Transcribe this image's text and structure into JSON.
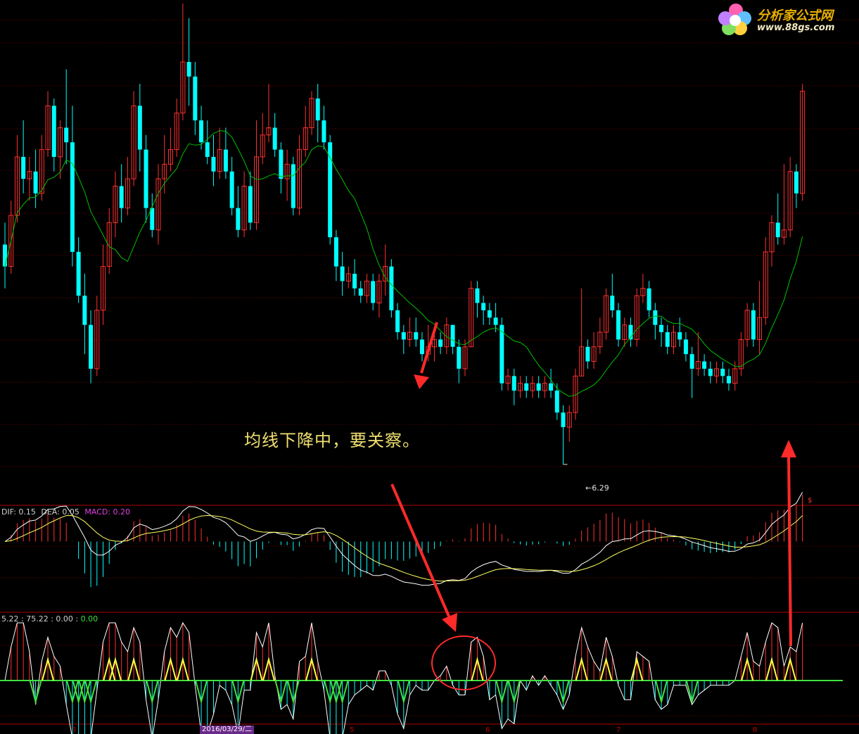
{
  "annotation": "均线下降中，要关察。",
  "logo": {
    "title": "分析家公式网",
    "url": "www.88gs.com"
  },
  "low_marker": "6.29",
  "macd_legend": {
    "dif_label": "DIF: 0.15",
    "dea_label": "DEA: 0.05",
    "macd_label": "MACD: 0.20"
  },
  "osc_legend": {
    "v1": "5.22",
    "v2": "75.22",
    "v3": "0.00",
    "v4": "0.00"
  },
  "x_ticks": [
    "3",
    "5",
    "6",
    "7",
    "8"
  ],
  "date_label": "2016/03/29/二",
  "dollar_mark": "$",
  "colors": {
    "up": "#ff3030",
    "down": "#00ffff",
    "ma": "#00c000",
    "dif": "#ffffff",
    "dea": "#ffff60",
    "grid": "#7a0000",
    "osc_green": "#40e040",
    "osc_yellow": "#ffff40",
    "arrow": "#ff2a2a"
  },
  "chart_data": [
    {
      "type": "candlestick",
      "series": [
        {
          "name": "price",
          "candles": [
            [
              9.3,
              9.0,
              9.6,
              8.7
            ],
            [
              9.0,
              9.7,
              9.9,
              8.9
            ],
            [
              9.7,
              10.5,
              10.8,
              9.6
            ],
            [
              10.5,
              10.2,
              11.0,
              10.0
            ],
            [
              10.2,
              10.3,
              10.5,
              9.9
            ],
            [
              10.3,
              10.0,
              10.6,
              9.8
            ],
            [
              10.0,
              10.6,
              10.8,
              9.9
            ],
            [
              10.6,
              11.2,
              11.4,
              10.5
            ],
            [
              11.2,
              10.5,
              11.3,
              10.3
            ],
            [
              10.5,
              10.9,
              11.0,
              10.2
            ],
            [
              10.9,
              10.7,
              11.7,
              10.4
            ],
            [
              10.7,
              9.2,
              11.2,
              9.0
            ],
            [
              9.2,
              8.6,
              9.4,
              8.5
            ],
            [
              8.6,
              8.2,
              8.9,
              7.8
            ],
            [
              8.2,
              7.6,
              8.4,
              7.4
            ],
            [
              7.6,
              8.4,
              8.6,
              7.5
            ],
            [
              8.4,
              9.0,
              9.3,
              8.2
            ],
            [
              9.0,
              9.6,
              9.8,
              8.9
            ],
            [
              9.6,
              10.1,
              10.3,
              9.4
            ],
            [
              10.1,
              9.8,
              10.4,
              9.6
            ],
            [
              9.8,
              10.2,
              10.5,
              9.7
            ],
            [
              10.2,
              11.2,
              11.4,
              10.1
            ],
            [
              11.2,
              10.6,
              11.5,
              10.3
            ],
            [
              10.6,
              9.8,
              10.8,
              9.6
            ],
            [
              9.8,
              9.5,
              10.0,
              9.4
            ],
            [
              9.5,
              10.2,
              10.4,
              9.3
            ],
            [
              10.2,
              10.4,
              10.8,
              10.0
            ],
            [
              10.4,
              10.6,
              10.9,
              10.3
            ],
            [
              10.6,
              11.1,
              11.3,
              10.5
            ],
            [
              11.1,
              11.8,
              12.6,
              11.0
            ],
            [
              11.8,
              11.6,
              12.4,
              11.2
            ],
            [
              11.6,
              11.0,
              11.8,
              10.8
            ],
            [
              11.0,
              10.7,
              11.2,
              10.6
            ],
            [
              10.7,
              10.5,
              11.0,
              10.4
            ],
            [
              10.5,
              10.3,
              10.8,
              10.1
            ],
            [
              10.3,
              10.6,
              10.9,
              10.2
            ],
            [
              10.6,
              10.3,
              10.9,
              10.2
            ],
            [
              10.3,
              9.8,
              10.5,
              9.7
            ],
            [
              9.8,
              9.5,
              10.1,
              9.4
            ],
            [
              9.5,
              10.1,
              10.3,
              9.4
            ],
            [
              10.1,
              9.6,
              10.3,
              9.5
            ],
            [
              9.6,
              10.5,
              11.0,
              9.5
            ],
            [
              10.5,
              10.8,
              11.1,
              10.4
            ],
            [
              10.8,
              10.9,
              11.5,
              10.7
            ],
            [
              10.9,
              10.6,
              11.1,
              10.5
            ],
            [
              10.6,
              10.2,
              10.7,
              10.0
            ],
            [
              10.2,
              10.4,
              10.6,
              9.9
            ],
            [
              10.4,
              9.8,
              10.5,
              9.7
            ],
            [
              9.8,
              10.6,
              10.8,
              9.7
            ],
            [
              10.6,
              10.9,
              11.2,
              10.5
            ],
            [
              10.9,
              11.3,
              11.4,
              10.8
            ],
            [
              11.3,
              11.0,
              11.5,
              10.7
            ],
            [
              11.0,
              10.7,
              11.2,
              10.6
            ],
            [
              10.7,
              9.4,
              10.8,
              9.3
            ],
            [
              9.4,
              9.0,
              9.5,
              8.8
            ],
            [
              9.0,
              8.8,
              9.2,
              8.6
            ],
            [
              8.8,
              8.9,
              9.0,
              8.7
            ],
            [
              8.9,
              8.7,
              9.1,
              8.6
            ],
            [
              8.7,
              8.6,
              8.8,
              8.5
            ],
            [
              8.6,
              8.8,
              8.9,
              8.5
            ],
            [
              8.8,
              8.5,
              8.9,
              8.4
            ],
            [
              8.5,
              8.8,
              8.9,
              8.3
            ],
            [
              8.8,
              9.0,
              9.3,
              8.6
            ],
            [
              9.0,
              8.4,
              9.1,
              8.3
            ],
            [
              8.4,
              8.1,
              8.5,
              8.0
            ],
            [
              8.1,
              8.0,
              8.2,
              7.8
            ],
            [
              8.0,
              8.1,
              8.3,
              7.9
            ],
            [
              8.1,
              8.0,
              8.3,
              7.9
            ],
            [
              8.0,
              7.8,
              8.1,
              7.7
            ],
            [
              7.8,
              7.9,
              8.2,
              7.7
            ],
            [
              7.9,
              8.0,
              8.1,
              7.7
            ],
            [
              8.0,
              7.9,
              8.1,
              7.8
            ],
            [
              7.9,
              8.2,
              8.3,
              7.8
            ],
            [
              8.2,
              7.9,
              8.2,
              7.8
            ],
            [
              7.9,
              7.6,
              8.0,
              7.4
            ],
            [
              7.6,
              7.9,
              8.0,
              7.5
            ],
            [
              7.9,
              8.7,
              8.8,
              7.9
            ],
            [
              8.7,
              8.5,
              8.8,
              8.3
            ],
            [
              8.5,
              8.4,
              8.6,
              8.2
            ],
            [
              8.4,
              8.3,
              8.5,
              8.2
            ],
            [
              8.3,
              8.2,
              8.5,
              8.1
            ],
            [
              8.2,
              7.4,
              8.3,
              7.3
            ],
            [
              7.4,
              7.5,
              7.6,
              7.3
            ],
            [
              7.5,
              7.3,
              7.6,
              7.1
            ],
            [
              7.3,
              7.4,
              7.5,
              7.2
            ],
            [
              7.4,
              7.3,
              7.5,
              7.2
            ],
            [
              7.3,
              7.4,
              7.5,
              7.2
            ],
            [
              7.4,
              7.3,
              7.5,
              7.2
            ],
            [
              7.3,
              7.4,
              7.5,
              7.2
            ],
            [
              7.4,
              7.3,
              7.6,
              7.2
            ],
            [
              7.3,
              7.0,
              7.4,
              6.9
            ],
            [
              7.0,
              6.8,
              7.1,
              6.29
            ],
            [
              6.8,
              7.0,
              7.1,
              6.6
            ],
            [
              7.0,
              7.5,
              7.6,
              6.9
            ],
            [
              7.5,
              7.9,
              8.7,
              7.5
            ],
            [
              7.9,
              7.7,
              8.0,
              7.6
            ],
            [
              7.7,
              7.9,
              8.1,
              7.6
            ],
            [
              7.9,
              8.1,
              8.3,
              7.8
            ],
            [
              8.1,
              8.6,
              8.7,
              8.0
            ],
            [
              8.6,
              8.4,
              8.9,
              8.3
            ],
            [
              8.4,
              8.0,
              8.5,
              7.9
            ],
            [
              8.0,
              8.2,
              8.3,
              7.9
            ],
            [
              8.2,
              8.0,
              8.3,
              7.9
            ],
            [
              8.0,
              8.6,
              8.7,
              7.9
            ],
            [
              8.6,
              8.7,
              8.9,
              8.5
            ],
            [
              8.7,
              8.4,
              8.8,
              8.3
            ],
            [
              8.4,
              8.2,
              8.5,
              8.0
            ],
            [
              8.2,
              8.1,
              8.3,
              7.9
            ],
            [
              8.1,
              7.9,
              8.2,
              7.8
            ],
            [
              7.9,
              8.1,
              8.2,
              7.8
            ],
            [
              8.1,
              8.0,
              8.3,
              7.9
            ],
            [
              8.0,
              7.8,
              8.1,
              7.7
            ],
            [
              7.8,
              7.6,
              7.9,
              7.2
            ],
            [
              7.6,
              7.7,
              8.1,
              7.5
            ],
            [
              7.7,
              7.6,
              7.8,
              7.5
            ],
            [
              7.6,
              7.5,
              7.7,
              7.4
            ],
            [
              7.5,
              7.6,
              7.7,
              7.4
            ],
            [
              7.6,
              7.5,
              7.7,
              7.4
            ],
            [
              7.5,
              7.4,
              7.6,
              7.3
            ],
            [
              7.4,
              7.6,
              7.7,
              7.3
            ],
            [
              7.6,
              8.0,
              8.1,
              7.5
            ],
            [
              8.0,
              8.4,
              8.5,
              7.9
            ],
            [
              8.4,
              8.0,
              8.5,
              7.9
            ],
            [
              8.0,
              8.3,
              8.8,
              7.8
            ],
            [
              8.3,
              9.2,
              9.4,
              8.2
            ],
            [
              9.2,
              9.6,
              9.7,
              9.0
            ],
            [
              9.6,
              9.4,
              10.0,
              9.3
            ],
            [
              9.4,
              9.5,
              10.4,
              9.3
            ],
            [
              9.5,
              10.3,
              10.5,
              9.4
            ],
            [
              10.3,
              10.0,
              10.4,
              9.8
            ],
            [
              10.0,
              11.4,
              11.5,
              9.9
            ]
          ]
        }
      ],
      "ylim": [
        6.0,
        12.6
      ]
    },
    {
      "type": "line",
      "series": [
        {
          "name": "DIF"
        },
        {
          "name": "DEA"
        },
        {
          "name": "MACD"
        }
      ],
      "ylim": [
        -0.9,
        0.35
      ]
    },
    {
      "type": "line",
      "ylim": [
        -1.0,
        1.0
      ]
    }
  ]
}
